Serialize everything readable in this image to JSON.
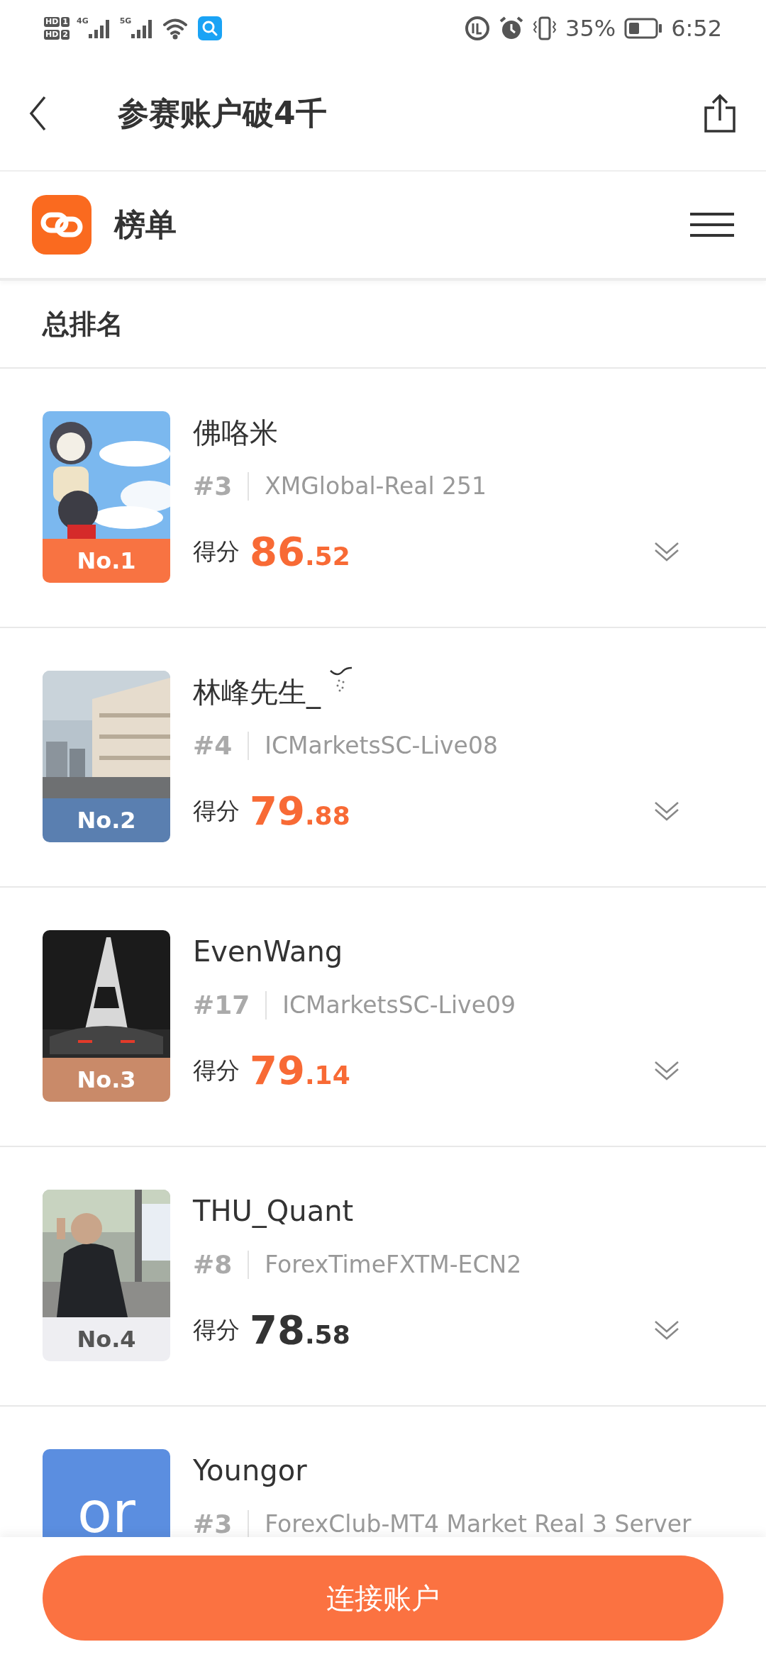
{
  "status_bar": {
    "sims": [
      {
        "hd": "HD",
        "slot": "1"
      },
      {
        "hd": "HD",
        "slot": "2"
      }
    ],
    "networks": [
      "4G",
      "5G"
    ],
    "battery": "35%",
    "time": "6:52"
  },
  "header": {
    "title": "参赛账户破4千"
  },
  "section": {
    "title": "榜单"
  },
  "ranking_title": "总排名",
  "entries": [
    {
      "badge": "No.1",
      "color": "#f87342",
      "name": "佛咯米",
      "name_icon": false,
      "rank": "#3",
      "server": "XMGlobal-Real 251",
      "score_label": "得分",
      "score_whole": "86",
      "score_decimal": ".52",
      "highlighted": true
    },
    {
      "badge": "No.2",
      "color": "#5a7fb0",
      "name": "林峰先生_",
      "name_icon": true,
      "rank": "#4",
      "server": "ICMarketsSC-Live08",
      "score_label": "得分",
      "score_whole": "79",
      "score_decimal": ".88",
      "highlighted": true
    },
    {
      "badge": "No.3",
      "color": "#c98a69",
      "name": "EvenWang",
      "name_icon": false,
      "rank": "#17",
      "server": "ICMarketsSC-Live09",
      "score_label": "得分",
      "score_whole": "79",
      "score_decimal": ".14",
      "highlighted": true
    },
    {
      "badge": "No.4",
      "color": "#eeeef2",
      "name": "THU_Quant",
      "name_icon": false,
      "rank": "#8",
      "server": "ForexTimeFXTM-ECN2",
      "score_label": "得分",
      "score_whole": "78",
      "score_decimal": ".58",
      "highlighted": false
    },
    {
      "avatar": {
        "kind": "text",
        "text": "or",
        "color": "#5b8ee0"
      },
      "name": "Youngor",
      "name_icon": false,
      "rank": "#3",
      "server": "ForexClub-MT4 Market Real 3 Server"
    }
  ],
  "connect_button": "连接账户"
}
